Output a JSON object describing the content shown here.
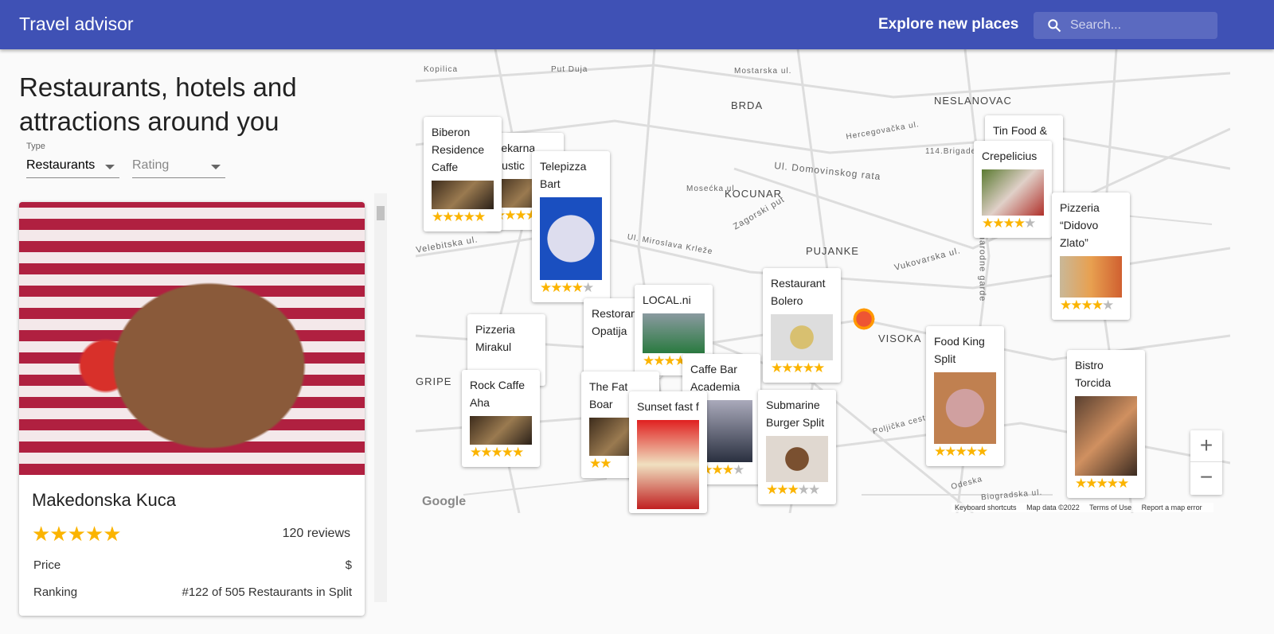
{
  "header": {
    "title": "Travel advisor",
    "explore": "Explore new places",
    "search_placeholder": "Search..."
  },
  "list": {
    "heading": "Restaurants, hotels and attractions around you",
    "type_label": "Type",
    "type_value": "Restaurants",
    "rating_placeholder": "Rating",
    "place": {
      "name": "Makedonska Kuca",
      "rating": 5,
      "stars": "★★★★★",
      "reviews": "120 reviews",
      "price_label": "Price",
      "price": "$",
      "ranking_label": "Ranking",
      "ranking": "#122 of 505 Restaurants in Split"
    }
  },
  "map": {
    "areas": [
      "BRDA",
      "NESLANOVAC",
      "KOCUNAR",
      "PUJANKE",
      "VISOKA",
      "GRIPE"
    ],
    "streets": [
      "Hercegovačka ul.",
      "114.Brigade",
      "Ul. Domovinskog rata",
      "Mosećka ul.",
      "Velebitska ul.",
      "Zagorski put",
      "Ul. Miroslava Krleže",
      "Vukovarska ul.",
      "Poljička cesta",
      "Biogradska ul.",
      "Odeska",
      "Ul. Zbora narodne garde",
      "Kopilica",
      "Put Duja",
      "Mostarska ul."
    ],
    "cards": [
      {
        "name": "Pekarna Rustic",
        "stars": "★★★★★",
        "empty": ""
      },
      {
        "name": "Biberon Residence Caffe",
        "stars": "★★★★★",
        "empty": ""
      },
      {
        "name": "Telepizza Bart",
        "stars": "★★★★",
        "empty": "★"
      },
      {
        "name": "Tin Food &",
        "stars": "",
        "empty": ""
      },
      {
        "name": "Crepelicius",
        "stars": "★★★★",
        "empty": "★"
      },
      {
        "name": "Pizzeria “Didovo Zlato”",
        "stars": "★★★★",
        "empty": "★"
      },
      {
        "name": "Restoran Opatija",
        "stars": "",
        "empty": ""
      },
      {
        "name": "Pizzeria Mirakul",
        "stars": "",
        "empty": ""
      },
      {
        "name": "LOCAL.ni",
        "stars": "★★★★★",
        "empty": ""
      },
      {
        "name": "Restaurant Bolero",
        "stars": "★★★★★",
        "empty": ""
      },
      {
        "name": "The Fat Boar",
        "stars": "★★",
        "empty": ""
      },
      {
        "name": "Rock Caffe Aha",
        "stars": "★★★★★",
        "empty": ""
      },
      {
        "name": "Caffe Bar Academia",
        "stars": "★★★★",
        "empty": "★"
      },
      {
        "name": "Sunset fast food",
        "stars": "",
        "empty": ""
      },
      {
        "name": "Submarine Burger Split",
        "stars": "★★★",
        "empty": "★★"
      },
      {
        "name": "Food King Split",
        "stars": "★★★★★",
        "empty": ""
      },
      {
        "name": "Bistro Torcida",
        "stars": "★★★★★",
        "empty": ""
      }
    ],
    "zoom_in": "+",
    "zoom_out": "−",
    "logo": "Google",
    "footer": [
      "Keyboard shortcuts",
      "Map data ©2022",
      "Terms of Use",
      "Report a map error"
    ]
  }
}
